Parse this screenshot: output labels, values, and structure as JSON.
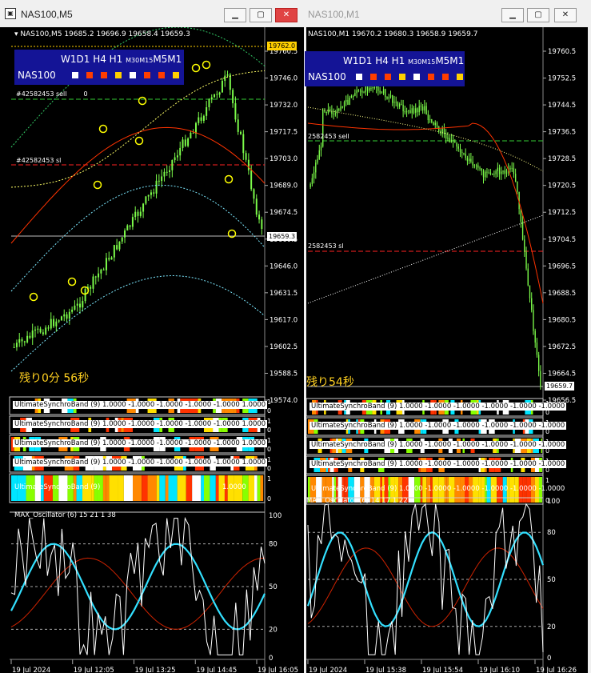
{
  "windows": [
    {
      "title": "NAS100,M5",
      "header": "NAS100,M5  19685.2 19696.9 19658.4 19659.3",
      "dashboard": {
        "timeframes_a": "W1D1 H4 H1 ",
        "timeframes_b": "M30M15",
        "timeframes_c": "M5M1",
        "symbol": "NAS100",
        "squares": [
          "#ffffff",
          "#ff3d00",
          "#ff3d00",
          "#ffd000",
          "#ffffff",
          "#ff3d00",
          "#ff3d00",
          "#ffd000"
        ]
      },
      "lines": {
        "sell": "#42582453 sell",
        "sell_vol": "0",
        "sl": "#42582453 sl"
      },
      "countdown": "残り0分 56秒",
      "price_ticks": [
        "19760.5",
        "19746.0",
        "19732.0",
        "19717.5",
        "19703.0",
        "19689.0",
        "19674.5",
        "19660.5",
        "19646.0",
        "19631.5",
        "19617.0",
        "19602.5",
        "19588.5",
        "19574.0"
      ],
      "price_tag_top": "19762.0",
      "price_tag_current": "19659.3",
      "band_label": "UltimateSynchroBand (9)",
      "band_value": "1.0000 -1.0000 -1.0000 -1.0000 -1.0000 1.0000",
      "band_value_short": "1.0000",
      "osc_label": "MAX_Oscillator (6) 15 21 1 38",
      "osc_ticks": [
        "100",
        "80",
        "50",
        "20",
        "0"
      ],
      "time_labels": [
        "19 Jul 2024",
        "19 Jul 12:05",
        "19 Jul 13:25",
        "19 Jul 14:45",
        "19 Jul 16:05"
      ]
    },
    {
      "title": "NAS100,M1",
      "header": "NAS100,M1  19670.2 19680.3 19658.9 19659.7",
      "dashboard": {
        "timeframes_a": "W1D1 H4 H1 ",
        "timeframes_b": "M30M15",
        "timeframes_c": "M5M1",
        "symbol": "NAS100",
        "squares": [
          "#ffffff",
          "#ff3d00",
          "#ff3d00",
          "#ffd000",
          "#ffffff",
          "#ff3d00",
          "#ff3d00",
          "#ffd000"
        ]
      },
      "lines": {
        "sell": "2582453 sell",
        "sl": "2582453 sl"
      },
      "countdown": "残り54秒",
      "price_ticks": [
        "19760.5",
        "19752.5",
        "19744.5",
        "19736.5",
        "19728.5",
        "19720.5",
        "19712.5",
        "19704.5",
        "19696.5",
        "19688.5",
        "19680.5",
        "19672.5",
        "19664.5",
        "19656.5"
      ],
      "price_tag_current": "19659.7",
      "band_label": "UltimateSynchroBand (9)",
      "band_value": "1.0000 -1.0000 -1.0000 -1.0000 -1.0000 -1.0000",
      "osc_label": "MAX_Oscillator (6) 14 17 1 22",
      "osc_ticks": [
        "100",
        "80",
        "50",
        "20",
        "0"
      ],
      "time_labels": [
        "19 Jul 2024",
        "19 Jul 15:38",
        "19 Jul 15:54",
        "19 Jul 16:10",
        "19 Jul 16:26"
      ]
    }
  ],
  "colors": {
    "candle": "#7cfc4a",
    "ma_red": "#ff3300",
    "band_dotted": "#7ce8ff",
    "yellow_dotted": "#ffff66",
    "osc_cyan": "#33e0ff",
    "osc_orange": "#ff6a00",
    "circle": "#ffff00"
  }
}
